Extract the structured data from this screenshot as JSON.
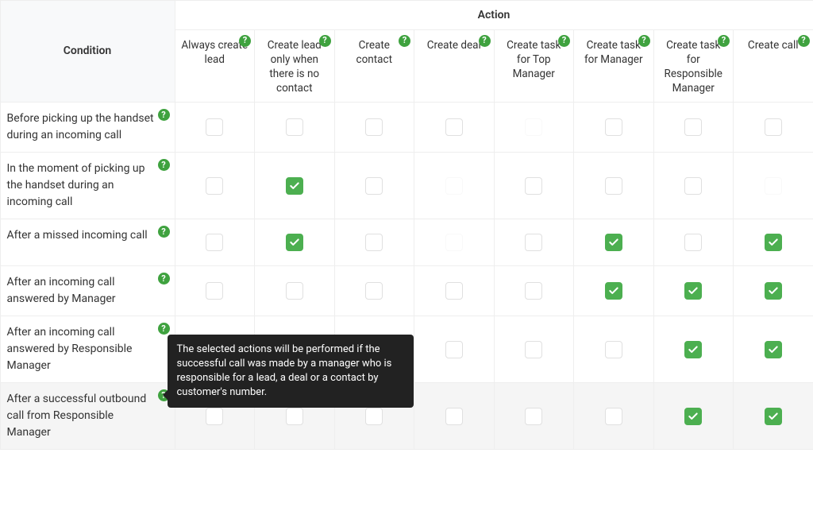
{
  "headers": {
    "condition": "Condition",
    "action": "Action"
  },
  "columns": [
    {
      "id": "always-create-lead",
      "label": "Always create lead"
    },
    {
      "id": "create-lead-no-contact",
      "label": "Create lead only when there is no contact"
    },
    {
      "id": "create-contact",
      "label": "Create contact"
    },
    {
      "id": "create-deal",
      "label": "Create deal"
    },
    {
      "id": "create-task-top-manager",
      "label": "Create task for Top Manager"
    },
    {
      "id": "create-task-manager",
      "label": "Create task for Manager"
    },
    {
      "id": "create-task-responsible-manager",
      "label": "Create task for Responsible Manager"
    },
    {
      "id": "create-call",
      "label": "Create call"
    }
  ],
  "rows": [
    {
      "id": "before-picking-up",
      "label": "Before picking up the handset during an incoming call",
      "cells": [
        false,
        false,
        false,
        false,
        "faded",
        false,
        false,
        false
      ]
    },
    {
      "id": "moment-picking-up",
      "label": "In the moment of picking up the handset during an incoming call",
      "cells": [
        false,
        true,
        false,
        "faded",
        false,
        false,
        false,
        "faded"
      ]
    },
    {
      "id": "after-missed",
      "label": "After a missed incoming call",
      "cells": [
        false,
        true,
        false,
        "faded",
        false,
        true,
        false,
        true
      ]
    },
    {
      "id": "after-incoming-manager",
      "label": "After an incoming call answered by Manager",
      "cells": [
        false,
        false,
        false,
        false,
        false,
        true,
        true,
        true
      ]
    },
    {
      "id": "after-incoming-responsible",
      "label": "After an incoming call answered by Responsible Manager",
      "cells": [
        false,
        false,
        false,
        false,
        false,
        false,
        true,
        true
      ]
    },
    {
      "id": "after-outbound-responsible",
      "label": "After a successful outbound call from Responsible Manager",
      "cells": [
        false,
        false,
        false,
        false,
        false,
        false,
        true,
        true
      ],
      "highlight": true,
      "tooltip": "The selected actions will be performed if the successful call was made by a manager who is responsible for a lead, a deal or a contact by customer's number."
    }
  ]
}
